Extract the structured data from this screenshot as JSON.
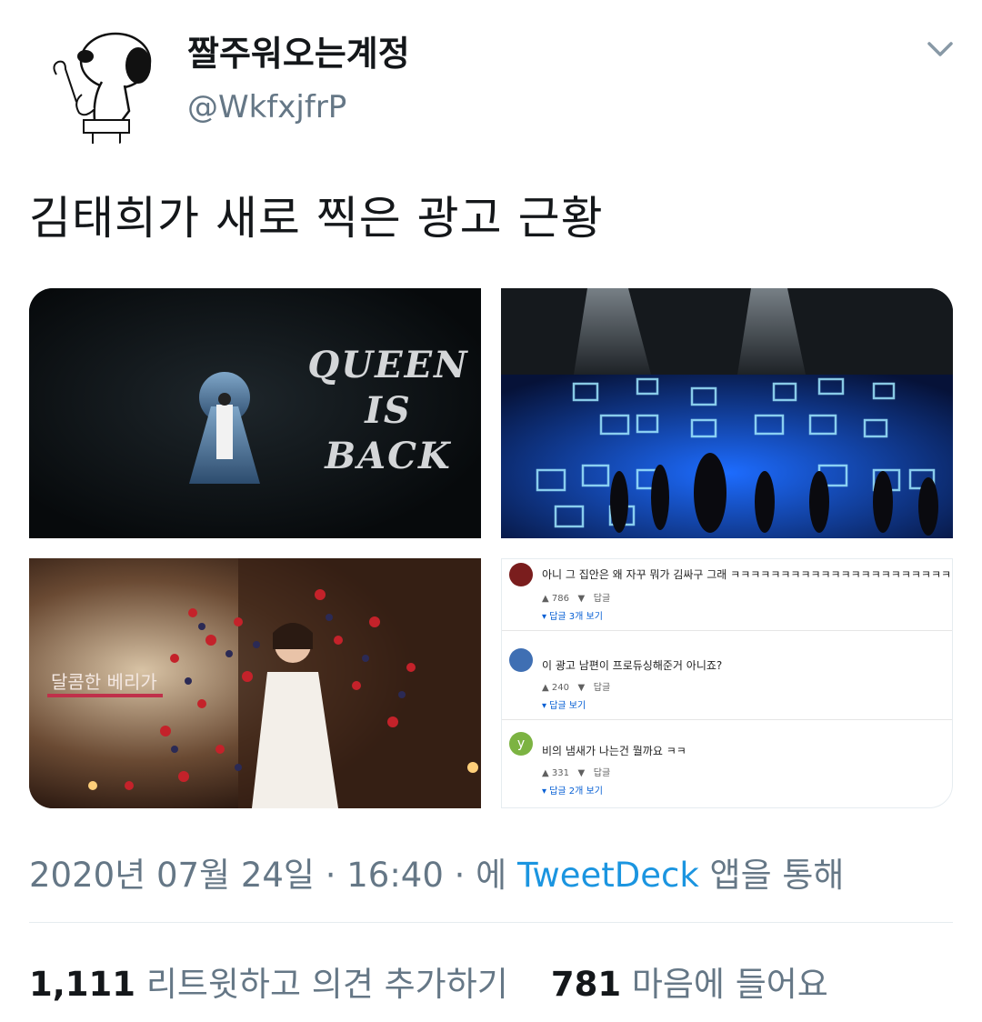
{
  "author": {
    "display_name": "짤주워오는계정",
    "handle": "@WkfxjfrP"
  },
  "tweet": {
    "text": "김태희가 새로 찍은 광고 근황"
  },
  "media": {
    "image1": {
      "lines": [
        "QUEEN",
        "IS",
        "BACK"
      ]
    },
    "image3": {
      "caption": "달콤한 베리가"
    },
    "comments": [
      {
        "text": "아니 그 집안은 왜 자꾸 뭐가 김싸구 그래 ㅋㅋㅋㅋㅋㅋㅋㅋㅋㅋㅋㅋㅋㅋㅋㅋㅋㅋㅋㅋㅋㅋㅋㅋㅋㅋㅋ",
        "likes": "786",
        "reply": "답글",
        "view_replies": "답글 3개 보기",
        "avatar_color": "#7a1d1d"
      },
      {
        "text": "이 광고 남편이 프로듀싱해준거 아니죠?",
        "likes": "240",
        "reply": "답글",
        "view_replies": "답글 보기",
        "avatar_color": "#3f6fb3"
      },
      {
        "text": "비의 냄새가 나는건 뭘까요 ㅋㅋ",
        "likes": "331",
        "reply": "답글",
        "view_replies": "답글 2개 보기",
        "avatar_color": "#7cb342",
        "avatar_letter": "y"
      }
    ]
  },
  "footer": {
    "timestamp": "2020년 07월 24일 · 16:40 · 에",
    "source": "TweetDeck",
    "source_suffix": "앱을 통해",
    "retweets_count": "1,111",
    "retweets_label": "리트윗하고 의견 추가하기",
    "likes_count": "781",
    "likes_label": "마음에 들어요"
  },
  "colors": {
    "link": "#1b95e0",
    "secondary_text": "#657786",
    "primary_text": "#14171a"
  }
}
